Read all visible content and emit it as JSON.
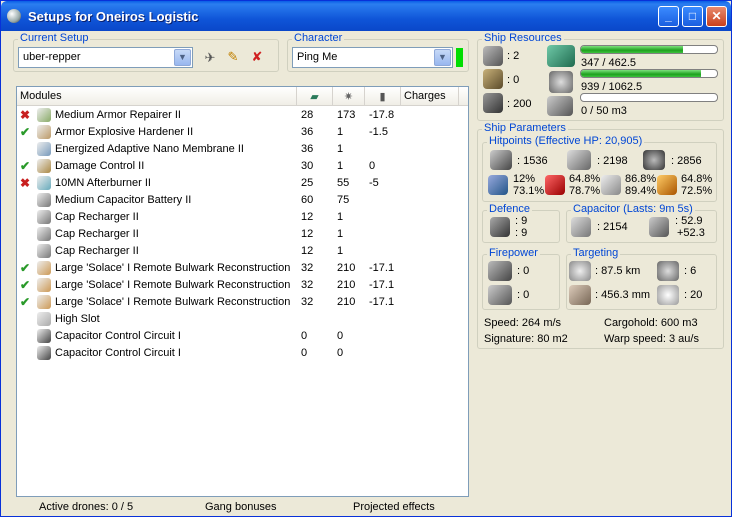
{
  "window": {
    "title": "Setups for Oneiros Logistic"
  },
  "current_setup": {
    "label": "Current Setup",
    "value": "uber-repper"
  },
  "character": {
    "label": "Character",
    "value": "Ping Me"
  },
  "modules": {
    "headers": {
      "name": "Modules",
      "charges": "Charges"
    },
    "rows": [
      {
        "state": "✖",
        "state_type": "off",
        "name": "Medium Armor Repairer II",
        "c1": "28",
        "c2": "173",
        "c3": "-17.8"
      },
      {
        "state": "✔",
        "state_type": "ok",
        "name": "Armor Explosive Hardener II",
        "c1": "36",
        "c2": "1",
        "c3": "-1.5"
      },
      {
        "state": "",
        "state_type": "",
        "name": "Energized Adaptive Nano Membrane II",
        "c1": "36",
        "c2": "1",
        "c3": ""
      },
      {
        "state": "✔",
        "state_type": "ok",
        "name": "Damage Control II",
        "c1": "30",
        "c2": "1",
        "c3": "0"
      },
      {
        "state": "✖",
        "state_type": "off",
        "name": "10MN Afterburner II",
        "c1": "25",
        "c2": "55",
        "c3": "-5"
      },
      {
        "state": "",
        "state_type": "",
        "name": "Medium Capacitor Battery II",
        "c1": "60",
        "c2": "75",
        "c3": ""
      },
      {
        "state": "",
        "state_type": "",
        "name": "Cap Recharger II",
        "c1": "12",
        "c2": "1",
        "c3": ""
      },
      {
        "state": "",
        "state_type": "",
        "name": "Cap Recharger II",
        "c1": "12",
        "c2": "1",
        "c3": ""
      },
      {
        "state": "",
        "state_type": "",
        "name": "Cap Recharger II",
        "c1": "12",
        "c2": "1",
        "c3": ""
      },
      {
        "state": "✔",
        "state_type": "ok",
        "name": "Large 'Solace' I Remote Bulwark Reconstruction",
        "c1": "32",
        "c2": "210",
        "c3": "-17.1"
      },
      {
        "state": "✔",
        "state_type": "ok",
        "name": "Large 'Solace' I Remote Bulwark Reconstruction",
        "c1": "32",
        "c2": "210",
        "c3": "-17.1"
      },
      {
        "state": "✔",
        "state_type": "ok",
        "name": "Large 'Solace' I Remote Bulwark Reconstruction",
        "c1": "32",
        "c2": "210",
        "c3": "-17.1"
      },
      {
        "state": "",
        "state_type": "",
        "name": "High Slot",
        "c1": "",
        "c2": "",
        "c3": ""
      },
      {
        "state": "",
        "state_type": "",
        "name": "Capacitor Control Circuit I",
        "c1": "0",
        "c2": "0",
        "c3": ""
      },
      {
        "state": "",
        "state_type": "",
        "name": "Capacitor Control Circuit I",
        "c1": "0",
        "c2": "0",
        "c3": ""
      }
    ]
  },
  "status": {
    "drones": "Active drones: 0 / 5",
    "gang": "Gang bonuses",
    "projected": "Projected effects"
  },
  "resources": {
    "label": "Ship Resources",
    "hardpoints_turret": ": 2",
    "hardpoints_launcher": ": 0",
    "calibration": ": 200",
    "cpu": "347 / 462.5",
    "cpu_fill": 0.75,
    "power": "939 / 1062.5",
    "power_fill": 0.884,
    "drone_bay": "0 / 50 m3",
    "drone_fill": 0
  },
  "parameters": {
    "label": "Ship Parameters",
    "hitpoints_label": "Hitpoints (Effective HP: 20,905)",
    "shield_hp": ": 1536",
    "armor_hp": ": 2198",
    "hull_hp": ": 2856",
    "res_em_shield": "12%",
    "res_em_armor": "73.1%",
    "res_th_shield": "64.8%",
    "res_th_armor": "78.7%",
    "res_ki_shield": "86.8%",
    "res_ki_armor": "89.4%",
    "res_ex_shield": "64.8%",
    "res_ex_armor": "72.5%",
    "defence_label": "Defence",
    "defence_1": ": 9",
    "defence_2": ": 9",
    "capacitor_label": "Capacitor (Lasts: 9m 5s)",
    "capacitor_amount": ": 2154",
    "capacitor_delta_1": ": 52.9",
    "capacitor_delta_2": "+52.3",
    "firepower_label": "Firepower",
    "firepower_1": ": 0",
    "firepower_2": ": 0",
    "targeting_label": "Targeting",
    "target_range": ": 87.5 km",
    "max_targets": ": 6",
    "scan_res": ": 456.3 mm",
    "sensor_strength": ": 20",
    "speed": "Speed: 264 m/s",
    "cargohold": "Cargohold: 600 m3",
    "signature": "Signature: 80 m2",
    "warp": "Warp speed: 3 au/s"
  }
}
